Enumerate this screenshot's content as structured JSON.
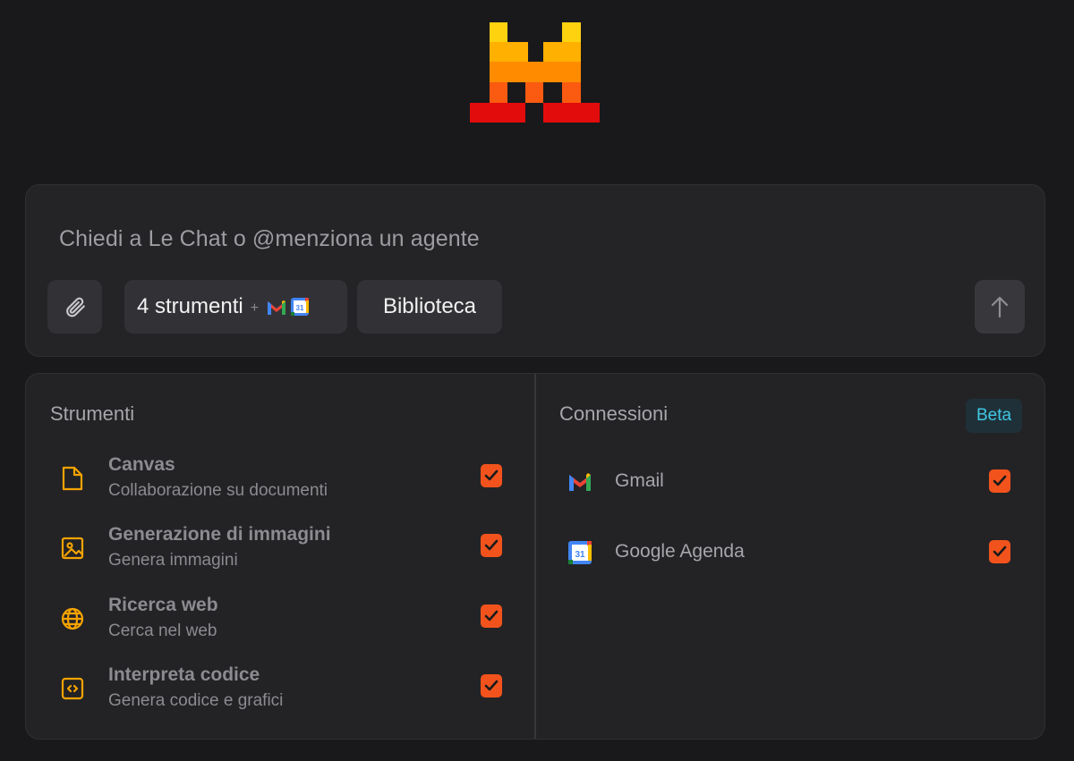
{
  "composer": {
    "placeholder": "Chiedi a Le Chat o @menziona un agente",
    "attach_icon": "paperclip-icon",
    "tools_label": "4 strumenti",
    "tools_plus": "+",
    "library_label": "Biblioteca",
    "send_icon": "arrow-up-icon"
  },
  "tools": {
    "title": "Strumenti",
    "items": [
      {
        "name": "Canvas",
        "description": "Collaborazione su documenti",
        "icon": "document-icon",
        "checked": true
      },
      {
        "name": "Generazione di immagini",
        "description": "Genera immagini",
        "icon": "image-icon",
        "checked": true
      },
      {
        "name": "Ricerca web",
        "description": "Cerca nel web",
        "icon": "globe-icon",
        "checked": true
      },
      {
        "name": "Interpreta codice",
        "description": "Genera codice e grafici",
        "icon": "code-icon",
        "checked": true
      }
    ]
  },
  "connections": {
    "title": "Connessioni",
    "badge": "Beta",
    "items": [
      {
        "name": "Gmail",
        "icon": "gmail-icon",
        "checked": true
      },
      {
        "name": "Google Agenda",
        "icon": "google-calendar-icon",
        "checked": true
      }
    ]
  },
  "colors": {
    "accent": "#f2531c",
    "tool_icon": "#f5a300",
    "beta_text": "#3fc8e4"
  }
}
